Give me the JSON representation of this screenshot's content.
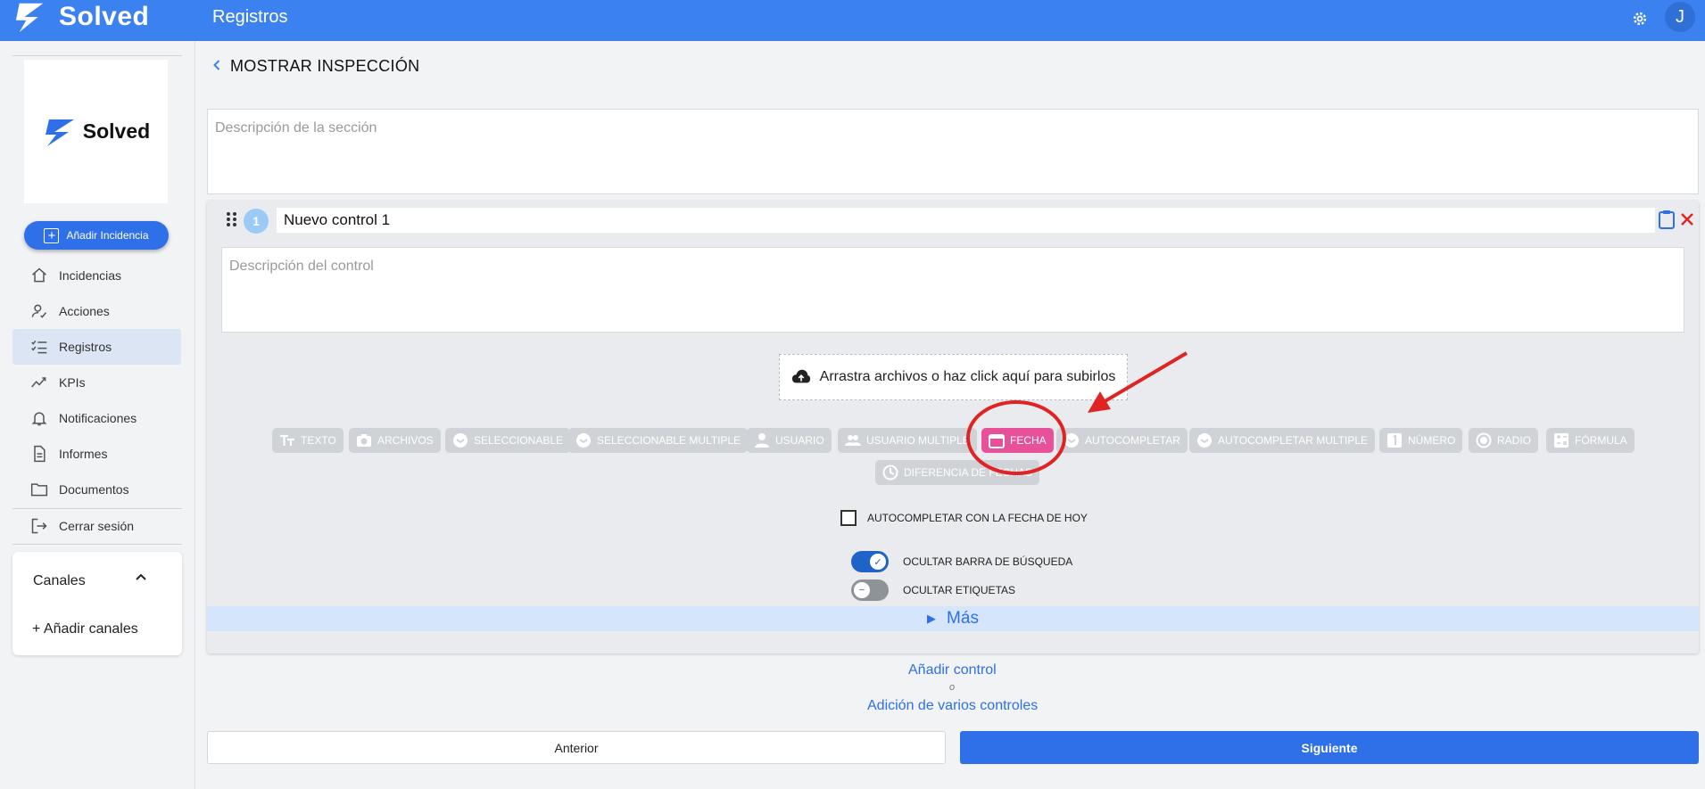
{
  "app": {
    "brand": "Solved",
    "section_title": "Registros",
    "user_initial": "J"
  },
  "sidebar": {
    "brand": "Solved",
    "add_button_label": "Añadir Incidencia",
    "items": [
      {
        "label": "Incidencias",
        "icon": "home-icon"
      },
      {
        "label": "Acciones",
        "icon": "user-check-icon"
      },
      {
        "label": "Registros",
        "icon": "checklist-icon",
        "active": true
      },
      {
        "label": "KPIs",
        "icon": "trend-icon"
      },
      {
        "label": "Notificaciones",
        "icon": "bell-icon"
      },
      {
        "label": "Informes",
        "icon": "document-icon"
      },
      {
        "label": "Documentos",
        "icon": "folder-icon"
      },
      {
        "label": "Cerrar sesión",
        "icon": "logout-icon"
      }
    ],
    "channels": {
      "title": "Canales",
      "add_label": "+ Añadir canales"
    }
  },
  "main": {
    "title": "MOSTRAR INSPECCIÓN",
    "section_description_placeholder": "Descripción de la sección",
    "control": {
      "number": "1",
      "name": "Nuevo control 1",
      "description_placeholder": "Descripción del control",
      "dropzone_label": "Arrastra archivos o haz click aquí para subirlos",
      "types": [
        {
          "label": "TEXTO",
          "icon": "text-icon"
        },
        {
          "label": "ARCHIVOS",
          "icon": "camera-icon"
        },
        {
          "label": "SELECCIONABLE",
          "icon": "select-icon"
        },
        {
          "label": "SELECCIONABLE MULTIPLE",
          "icon": "select-icon"
        },
        {
          "label": "USUARIO",
          "icon": "user-icon"
        },
        {
          "label": "USUARIO MULTIPLE",
          "icon": "users-icon"
        },
        {
          "label": "FECHA",
          "icon": "calendar-icon",
          "active": true
        },
        {
          "label": "AUTOCOMPLETAR",
          "icon": "select-icon"
        },
        {
          "label": "AUTOCOMPLETAR MULTIPLE",
          "icon": "select-icon"
        },
        {
          "label": "NÚMERO",
          "icon": "number-icon"
        },
        {
          "label": "RADIO",
          "icon": "radio-icon"
        },
        {
          "label": "FÓRMULA",
          "icon": "formula-icon"
        },
        {
          "label": "DIFERENCIA DE FECHAS",
          "icon": "date-diff-icon"
        }
      ],
      "autofill_today_label": "AUTOCOMPLETAR CON LA FECHA DE HOY",
      "autofill_today_checked": false,
      "hide_search_label": "OCULTAR BARRA DE BÚSQUEDA",
      "hide_search_on": true,
      "hide_tags_label": "OCULTAR ETIQUETAS",
      "hide_tags_on": false,
      "more_label": "Más"
    },
    "add_control_label": "Añadir control",
    "or_label": "o",
    "add_multiple_label": "Adición de varios controles",
    "prev_label": "Anterior",
    "next_label": "Siguiente"
  },
  "colors": {
    "primary": "#3b82f0",
    "active_chip": "#e7519a",
    "annotation": "#e02424"
  }
}
